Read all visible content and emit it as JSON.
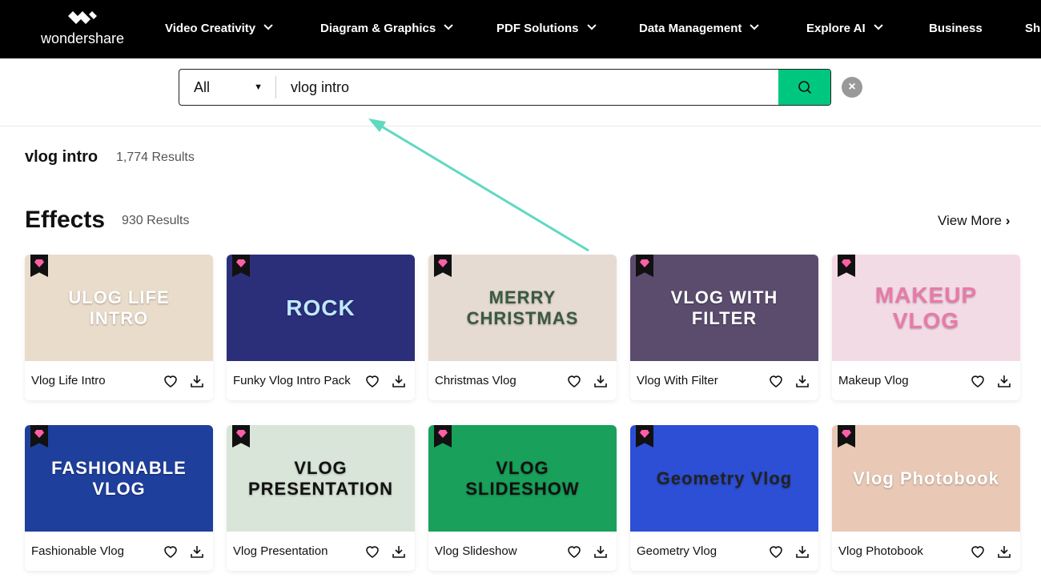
{
  "nav": {
    "logo": "wondershare",
    "items": [
      {
        "label": "Video Creativity",
        "dropdown": true
      },
      {
        "label": "Diagram & Graphics",
        "dropdown": true
      },
      {
        "label": "PDF Solutions",
        "dropdown": true
      },
      {
        "label": "Data Management",
        "dropdown": true
      },
      {
        "label": "Explore AI",
        "dropdown": true
      },
      {
        "label": "Business",
        "dropdown": false
      },
      {
        "label": "Sh",
        "dropdown": false
      }
    ]
  },
  "search": {
    "category": "All",
    "value": "vlog intro",
    "button_color": "#00c77f"
  },
  "results": {
    "query": "vlog intro",
    "count": "1,774 Results"
  },
  "section": {
    "title": "Effects",
    "count": "930 Results",
    "view_more": "View More"
  },
  "cards": [
    {
      "title": "Vlog Life Intro",
      "thumb_text": "ULOG LIFE INTRO",
      "bg": "#eadccb",
      "fg": "#fff"
    },
    {
      "title": "Funky Vlog Intro Pack",
      "thumb_text": "ROCK",
      "bg": "#2b2f7a",
      "fg": "#bfe8ff"
    },
    {
      "title": "Christmas Vlog",
      "thumb_text": "MERRY CHRISTMAS",
      "bg": "#e6dbd2",
      "fg": "#3a5a40"
    },
    {
      "title": "Vlog With Filter",
      "thumb_text": "VLOG WITH FILTER",
      "bg": "#5b4c6e",
      "fg": "#fff"
    },
    {
      "title": "Makeup Vlog",
      "thumb_text": "MAKEUP VLOG",
      "bg": "#f3dbe6",
      "fg": "#e87aa8"
    },
    {
      "title": "Fashionable Vlog",
      "thumb_text": "FASHIONABLE VLOG",
      "bg": "#1f3f9c",
      "fg": "#fff"
    },
    {
      "title": "Vlog Presentation",
      "thumb_text": "VLOG PRESENTATION",
      "bg": "#d9e5d8",
      "fg": "#111"
    },
    {
      "title": "Vlog Slideshow",
      "thumb_text": "VLOG SLIDESHOW",
      "bg": "#19a05a",
      "fg": "#111"
    },
    {
      "title": "Geometry Vlog",
      "thumb_text": "Geometry Vlog",
      "bg": "#2d4fd6",
      "fg": "#222"
    },
    {
      "title": "Vlog Photobook",
      "thumb_text": "Vlog Photobook",
      "bg": "#e9c9b6",
      "fg": "#fff"
    }
  ],
  "annotation": {
    "arrow_color": "#5fd9c0"
  }
}
